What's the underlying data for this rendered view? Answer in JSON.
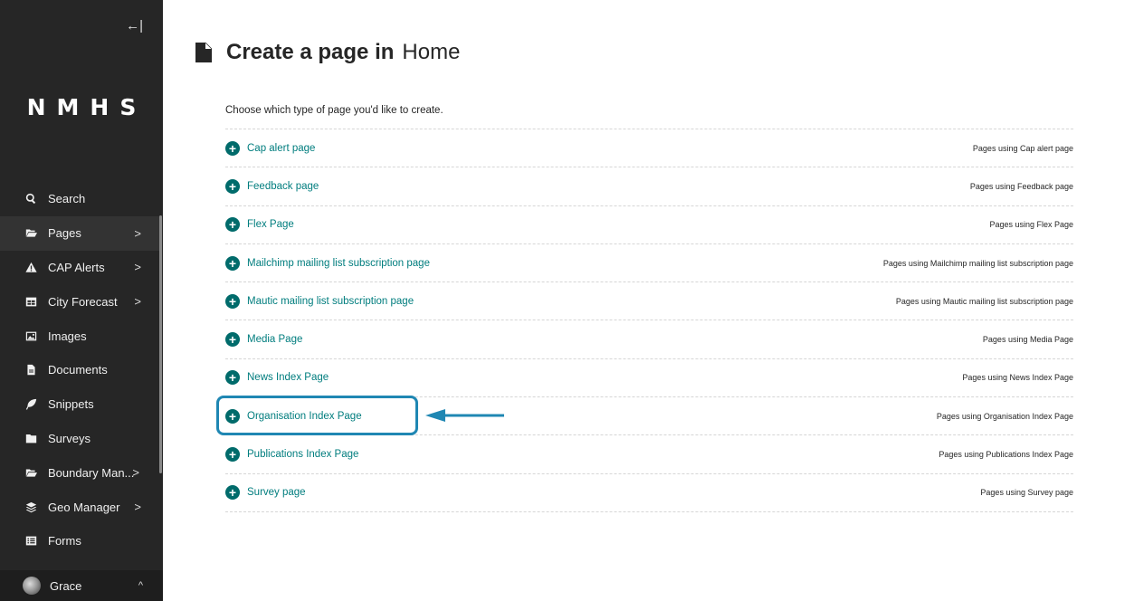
{
  "sidebar": {
    "collapse_icon": "←|",
    "logo": "NMHS",
    "items": [
      {
        "label": "Search",
        "icon": "search-icon",
        "chevron": ""
      },
      {
        "label": "Pages",
        "icon": "folder-open-icon",
        "chevron": ">"
      },
      {
        "label": "CAP Alerts",
        "icon": "warning-icon",
        "chevron": ">"
      },
      {
        "label": "City Forecast",
        "icon": "table-icon",
        "chevron": ">"
      },
      {
        "label": "Images",
        "icon": "image-icon",
        "chevron": ""
      },
      {
        "label": "Documents",
        "icon": "document-icon",
        "chevron": ""
      },
      {
        "label": "Snippets",
        "icon": "snippet-icon",
        "chevron": ""
      },
      {
        "label": "Surveys",
        "icon": "folder-icon",
        "chevron": ""
      },
      {
        "label": "Boundary Man...",
        "icon": "folder-open-icon",
        "chevron": ">"
      },
      {
        "label": "Geo Manager",
        "icon": "layers-icon",
        "chevron": ">"
      },
      {
        "label": "Forms",
        "icon": "form-icon",
        "chevron": ""
      }
    ],
    "user": {
      "name": "Grace",
      "chevron": "^"
    }
  },
  "header": {
    "title_strong": "Create a page in",
    "title_light": "Home"
  },
  "intro": "Choose which type of page you'd like to create.",
  "page_types": [
    {
      "label": "Cap alert page",
      "usage": "Pages using Cap alert page"
    },
    {
      "label": "Feedback page",
      "usage": "Pages using Feedback page"
    },
    {
      "label": "Flex Page",
      "usage": "Pages using Flex Page"
    },
    {
      "label": "Mailchimp mailing list subscription page",
      "usage": "Pages using Mailchimp mailing list subscription page"
    },
    {
      "label": "Mautic mailing list subscription page",
      "usage": "Pages using Mautic mailing list subscription page"
    },
    {
      "label": "Media Page",
      "usage": "Pages using Media Page"
    },
    {
      "label": "News Index Page",
      "usage": "Pages using News Index Page"
    },
    {
      "label": "Organisation Index Page",
      "usage": "Pages using Organisation Index Page"
    },
    {
      "label": "Publications Index Page",
      "usage": "Pages using Publications Index Page"
    },
    {
      "label": "Survey page",
      "usage": "Pages using Survey page"
    }
  ],
  "colors": {
    "sidebar_bg": "#262626",
    "link": "#007d7e",
    "plus_icon": "#006b6b",
    "highlight": "#1f87b3"
  }
}
